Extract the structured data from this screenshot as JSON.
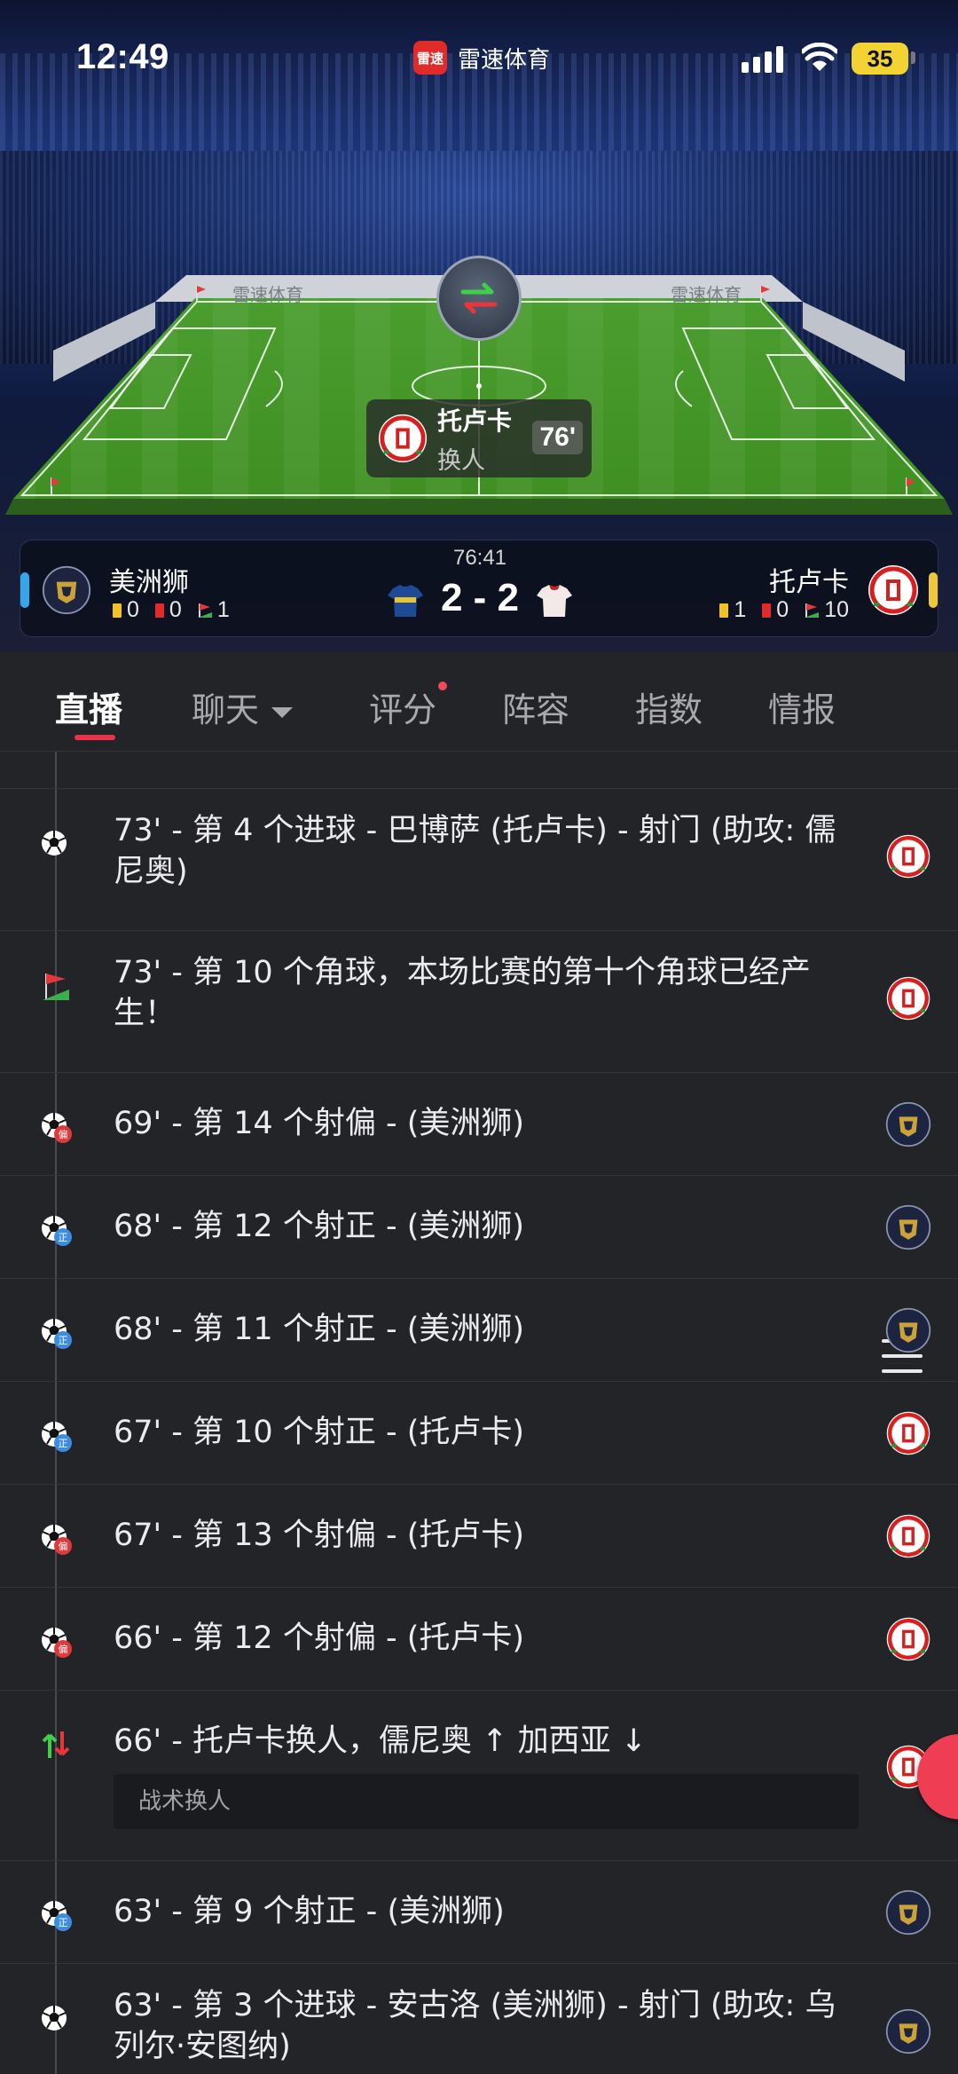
{
  "status_bar": {
    "time": "12:49",
    "battery": "35"
  },
  "app": {
    "name": "雷速体育",
    "logo": "雷速"
  },
  "pitch": {
    "ad_text": "雷速体育"
  },
  "popup": {
    "team": "托卢卡",
    "action": "换人",
    "minute": "76'"
  },
  "match": {
    "clock": "76:41",
    "score": "2 - 2",
    "home": {
      "name": "美洲狮",
      "yellow": "0",
      "red": "0",
      "corners": "1",
      "stripe_color": "#36a6ea"
    },
    "away": {
      "name": "托卢卡",
      "yellow": "1",
      "red": "0",
      "corners": "10",
      "stripe_color": "#f0c73a"
    }
  },
  "tabs": [
    {
      "label": "直播",
      "active": true
    },
    {
      "label": "聊天"
    },
    {
      "label": "评分"
    },
    {
      "label": "阵容"
    },
    {
      "label": "指数"
    },
    {
      "label": "情报"
    }
  ],
  "events": [
    {
      "text": "73' - 第 4 个进球 - 巴博萨 (托卢卡) - 射门 (助攻: 儒尼奥)",
      "icon": "goal-icon",
      "team": "away"
    },
    {
      "text": "73' - 第 10 个角球，本场比赛的第十个角球已经产生！",
      "icon": "corner-flag-icon",
      "team": "away"
    },
    {
      "text": "69' - 第 14 个射偏 - (美洲狮)",
      "icon": "shot-off-target-icon",
      "team": "home"
    },
    {
      "text": "68' - 第 12 个射正 - (美洲狮)",
      "icon": "shot-on-target-icon",
      "team": "home"
    },
    {
      "text": "68' - 第 11 个射正 - (美洲狮)",
      "icon": "shot-on-target-icon",
      "team": "home"
    },
    {
      "text": "67' - 第 10 个射正 - (托卢卡)",
      "icon": "shot-on-target-icon",
      "team": "away"
    },
    {
      "text": "67' - 第 13 个射偏 - (托卢卡)",
      "icon": "shot-off-target-icon",
      "team": "away"
    },
    {
      "text": "66' - 第 12 个射偏 - (托卢卡)",
      "icon": "shot-off-target-icon",
      "team": "away"
    },
    {
      "text": "66' - 托卢卡换人，儒尼奥 ↑ 加西亚 ↓",
      "note": "战术换人",
      "icon": "substitution-icon",
      "team": "away"
    },
    {
      "text": "63' - 第 9 个射正 - (美洲狮)",
      "icon": "shot-on-target-icon",
      "team": "home"
    },
    {
      "text": "63' - 第 3 个进球 - 安古洛 (美洲狮) - 射门 (助攻: 乌列尔·安图纳)",
      "icon": "goal-icon",
      "team": "home"
    }
  ],
  "icon_badges": {
    "on_target": "正",
    "off_target": "偏"
  },
  "colors": {
    "accent": "#e8334a",
    "background": "#232427"
  }
}
